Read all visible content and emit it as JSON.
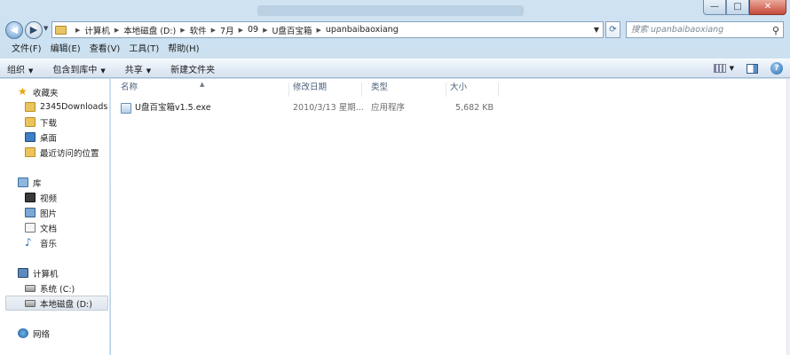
{
  "window": {
    "minimize": "—",
    "maximize": "□",
    "close": "✕"
  },
  "address": {
    "crumbs": [
      "计算机",
      "本地磁盘 (D:)",
      "软件",
      "7月",
      "09",
      "U盘百宝箱",
      "upanbaibaoxiang"
    ],
    "search_placeholder": "搜索 upanbaibaoxiang"
  },
  "menu": [
    "文件(F)",
    "编辑(E)",
    "查看(V)",
    "工具(T)",
    "帮助(H)"
  ],
  "toolbar": {
    "organize": "组织",
    "include_library": "包含到库中",
    "share": "共享",
    "new_folder": "新建文件夹"
  },
  "nav": {
    "favorites": "收藏夹",
    "fav_items": [
      "2345Downloads",
      "下载",
      "桌面",
      "最近访问的位置"
    ],
    "libraries": "库",
    "lib_items": [
      "视频",
      "图片",
      "文档",
      "音乐"
    ],
    "computer": "计算机",
    "drives": [
      "系统 (C:)",
      "本地磁盘 (D:)"
    ],
    "network": "网络"
  },
  "columns": {
    "name": "名称",
    "modified": "修改日期",
    "type": "类型",
    "size": "大小"
  },
  "files": [
    {
      "name": "U盘百宝箱v1.5.exe",
      "modified": "2010/3/13 星期...",
      "type": "应用程序",
      "size": "5,682 KB"
    }
  ]
}
